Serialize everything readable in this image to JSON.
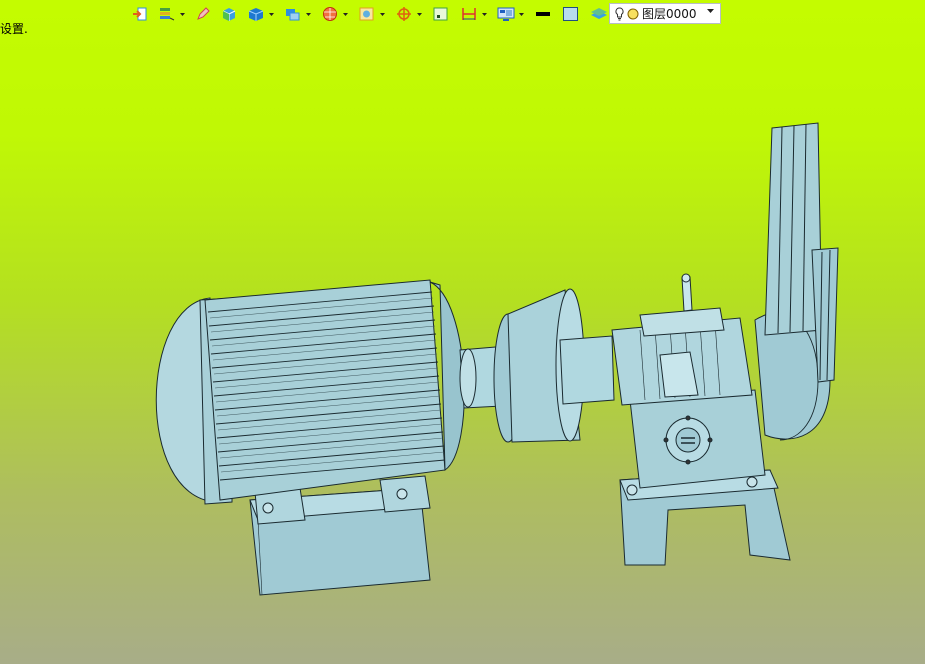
{
  "toolbar": {
    "buttons": [
      {
        "name": "import-icon",
        "color": "#2e8ee0"
      },
      {
        "name": "layers-stack-icon",
        "color": "#48a040"
      },
      {
        "name": "pencil-icon",
        "color": "#d04050"
      },
      {
        "name": "box-solid-icon",
        "color": "#3aa0e0"
      },
      {
        "name": "cube-view-icon",
        "color": "#1e78d0"
      },
      {
        "name": "display-mode-icon",
        "color": "#2e8ee0"
      },
      {
        "name": "render-sphere-icon",
        "color": "#e05030"
      },
      {
        "name": "section-view-icon",
        "color": "#e0a020"
      },
      {
        "name": "move-target-icon",
        "color": "#e06010"
      },
      {
        "name": "frame-square-icon",
        "color": "#40a040"
      },
      {
        "name": "measure-icon",
        "color": "#e03030"
      },
      {
        "name": "monitor-icon",
        "color": "#2060c0"
      }
    ]
  },
  "layer_selector": {
    "value": "图层0000"
  },
  "status": {
    "text": "设置."
  },
  "colors": {
    "background_top": "#c4fc00",
    "background_bottom": "#a8ad88",
    "model_fill": "#a8d0d8",
    "model_edge": "#1a2a30"
  }
}
